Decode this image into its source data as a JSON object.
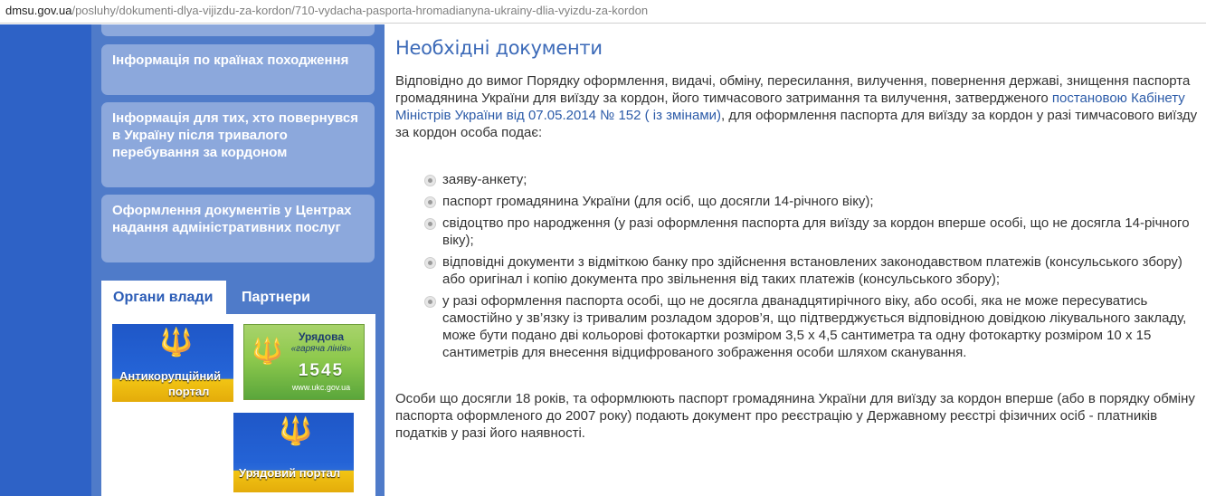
{
  "url": {
    "host": "dmsu.gov.ua",
    "path": "/posluhy/dokumenti-dlya-vijizdu-za-kordon/710-vydacha-pasporta-hromadianyna-ukrainy-dlia-vyizdu-za-kordon"
  },
  "sidebar": {
    "items": [
      {
        "label": "Інформація по країнах походження"
      },
      {
        "label": "Інформація для тих, хто повернувся в Україну після тривалого перебування за кордоном"
      },
      {
        "label": "Оформлення документів у Центрах надання адміністративних послуг"
      }
    ],
    "tabs": {
      "active": "Органи влади",
      "inactive": "Партнери"
    },
    "banners": {
      "anticorruption_line1": "Антикорупційний",
      "anticorruption_line2": "портал",
      "hotline_title": "Урядова",
      "hotline_sub": "«гаряча лінія»",
      "hotline_number": "1545",
      "hotline_site": "www.ukc.gov.ua",
      "gov_portal": "Урядовий портал"
    }
  },
  "main": {
    "title": "Необхідні документи",
    "intro_before_link": "Відповідно до вимог Порядку оформлення, видачі, обміну, пересилання, вилучення, повернення державі, знищення паспорта громадянина України для виїзду за кордон, його тимчасового затримання та вилучення, затвердженого ",
    "intro_link": "постановою Кабінету Міністрів України від 07.05.2014  № 152 ( із змінами)",
    "intro_after_link": ", для оформлення паспорта для виїзду за кордон у разі тимчасового виїзду за кордон особа подає:",
    "documents": [
      "заяву-анкету;",
      "паспорт громадянина України (для осіб, що досягли 14-річного віку);",
      "свідоцтво про народження (у разі оформлення паспорта для виїзду за кордон вперше особі, що не досягла 14-річного віку);",
      "відповідні документи з відміткою банку про здійснення встановлених законодавством платежів (консульського збору) або оригінал і копію документа про звільнення від таких платежів (консульського збору);",
      "у разі оформлення паспорта особі, що не досягла дванадцятирічного віку, або особі, яка не може пересуватись самостійно у зв’язку із тривалим розладом здоров’я, що підтверджується відповідною довідкою лікувального закладу, може бути подано дві кольорові фотокартки розміром 3,5 х 4,5 сантиметра та одну фотокартку розміром 10 х 15 сантиметрів для внесення відцифрованого зображення особи шляхом сканування."
    ],
    "outro": "Особи що досягли 18 років, та оформлюють паспорт громадянина України для виїзду за кордон вперше (або в порядку обміну паспорта оформленого до 2007 року) подають документ про реєстрацію у Державному реєстрі фізичних осіб - платників податків у разі його наявності."
  }
}
